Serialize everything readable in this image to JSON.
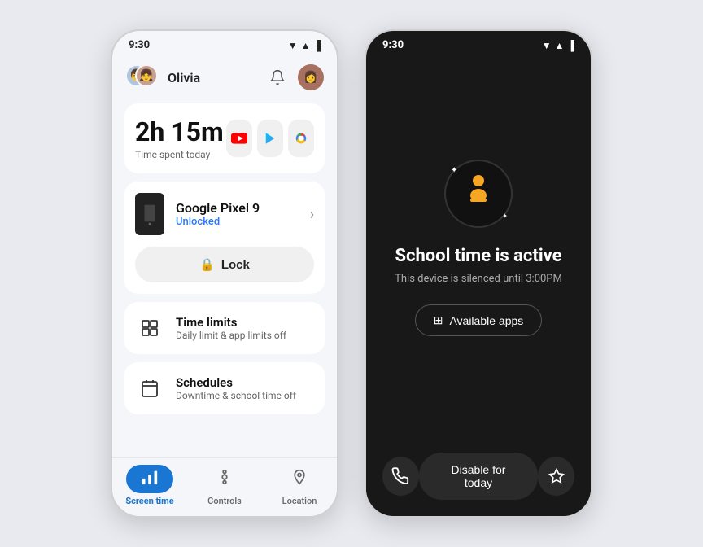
{
  "phone1": {
    "statusBar": {
      "time": "9:30",
      "icons": "▼▲▐"
    },
    "header": {
      "userName": "Olivia"
    },
    "timeCard": {
      "timeValue": "2h 15m",
      "timeLabel": "Time spent today",
      "apps": [
        "▶",
        "▷",
        "●"
      ]
    },
    "deviceCard": {
      "deviceName": "Google Pixel 9",
      "deviceStatus": "Unlocked"
    },
    "lockButton": {
      "label": "Lock",
      "icon": "🔒"
    },
    "timeLimits": {
      "title": "Time limits",
      "subtitle": "Daily limit & app limits off"
    },
    "schedules": {
      "title": "Schedules",
      "subtitle": "Downtime & school time off"
    },
    "bottomNav": {
      "items": [
        {
          "label": "Screen time",
          "active": true
        },
        {
          "label": "Controls",
          "active": false
        },
        {
          "label": "Location",
          "active": false
        }
      ]
    }
  },
  "phone2": {
    "statusBar": {
      "time": "9:30"
    },
    "schoolBadge": "🧑‍🎓",
    "title": "School time is active",
    "subtitle": "This device is silenced until 3:00PM",
    "availableAppsBtn": "Available apps",
    "disableBtn": "Disable for today"
  }
}
